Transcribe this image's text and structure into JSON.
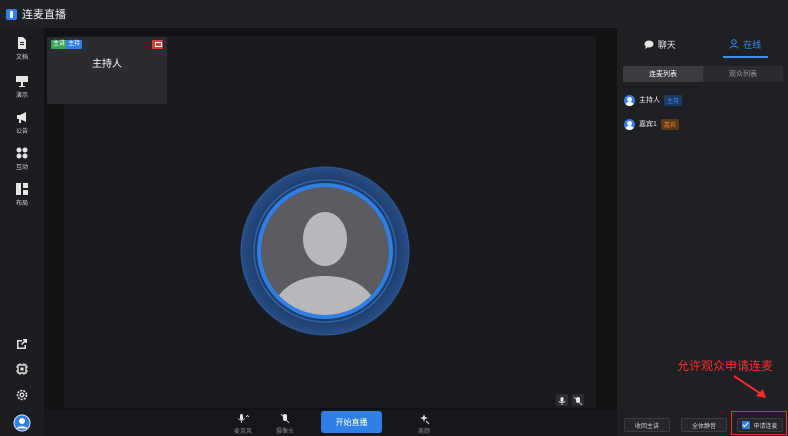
{
  "window": {
    "title": "连麦直播"
  },
  "sidebar": {
    "items": [
      {
        "label": "文档",
        "icon": "document-icon"
      },
      {
        "label": "演示",
        "icon": "presentation-icon"
      },
      {
        "label": "公告",
        "icon": "megaphone-icon"
      },
      {
        "label": "互动",
        "icon": "interaction-icon"
      },
      {
        "label": "布局",
        "icon": "layout-icon"
      }
    ],
    "bottom_icons": [
      "share-out-icon",
      "chip-icon",
      "settings-icon",
      "user-avatar-icon"
    ]
  },
  "stage": {
    "host_card": {
      "badges": [
        "主讲",
        "主持"
      ],
      "name": "主持人"
    },
    "avatar": "default-person-avatar"
  },
  "bottombar": {
    "mic_label": "麦克风",
    "camera_label": "摄像头",
    "start_label": "开始直播",
    "effect_label": "美颜"
  },
  "panel": {
    "tabs": [
      {
        "label": "聊天",
        "icon": "chat-bubble-icon",
        "active": false
      },
      {
        "label": "在线",
        "icon": "person-icon",
        "active": true
      }
    ],
    "subtabs": [
      {
        "label": "连麦列表",
        "active": true
      },
      {
        "label": "观众列表",
        "active": false
      }
    ],
    "members": [
      {
        "name": "主持人",
        "tag": "主持",
        "tag_color": "#2f7fe6"
      },
      {
        "name": "嘉宾1",
        "tag": "嘉宾",
        "tag_color": "#e67a2f"
      }
    ],
    "buttons": {
      "revoke": "收回主讲",
      "mute_all": "全体静音",
      "apply": "申请连麦"
    }
  },
  "annotation": {
    "text": "允许观众申请连麦",
    "color": "#ff2b2b"
  },
  "colors": {
    "accent": "#2f7fe6",
    "background": "#15171b",
    "panel": "#1e2024"
  }
}
